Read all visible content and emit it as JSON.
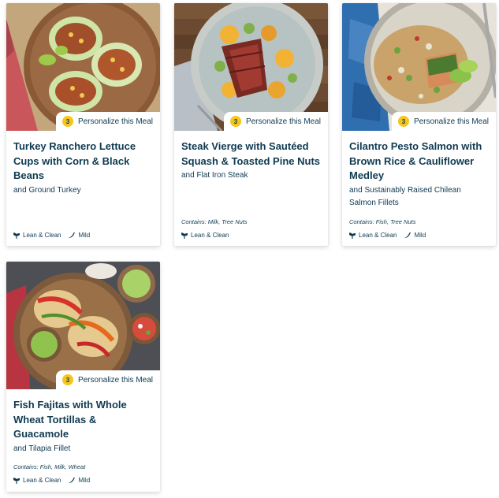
{
  "common": {
    "personalize_label": "Personalize this Meal",
    "badge_count": "3"
  },
  "meals": [
    {
      "title": "Turkey Ranchero Lettuce Cups with Corn & Black Beans",
      "subtitle": "and Ground Turkey",
      "contains": "",
      "tags": [
        "Lean & Clean",
        "Mild"
      ]
    },
    {
      "title": "Steak Vierge with Sautéed Squash & Toasted Pine Nuts",
      "subtitle": "and Flat Iron Steak",
      "contains": "Contains: Milk, Tree Nuts",
      "tags": [
        "Lean & Clean"
      ]
    },
    {
      "title": "Cilantro Pesto Salmon with Brown Rice & Cauliflower Medley",
      "subtitle": "and Sustainably Raised Chilean Salmon Fillets",
      "contains": "Contains: Fish, Tree Nuts",
      "tags": [
        "Lean & Clean",
        "Mild"
      ]
    },
    {
      "title": "Fish Fajitas with Whole Wheat Tortillas & Guacamole",
      "subtitle": "and Tilapia Fillet",
      "contains": "Contains: Fish, Milk, Wheat",
      "tags": [
        "Lean & Clean",
        "Mild"
      ]
    }
  ],
  "colors": {
    "text": "#0f3a52",
    "badge": "#f6c619",
    "card_bg": "#ffffff"
  },
  "icons": {
    "lean_clean": "sprout-icon",
    "mild": "chili-pepper-icon"
  }
}
